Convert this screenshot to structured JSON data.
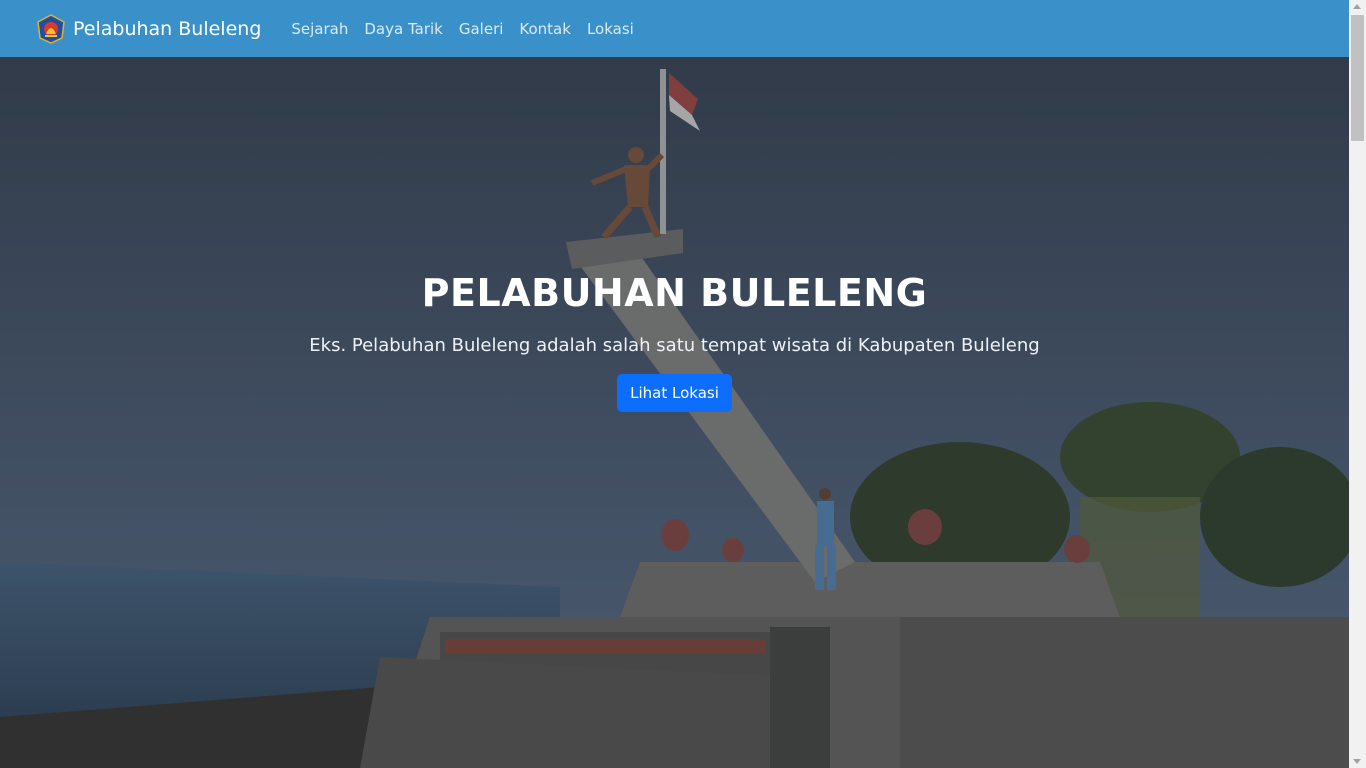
{
  "navbar": {
    "brand": "Pelabuhan Buleleng",
    "links": [
      {
        "label": "Sejarah"
      },
      {
        "label": "Daya Tarik"
      },
      {
        "label": "Galeri"
      },
      {
        "label": "Kontak"
      },
      {
        "label": "Lokasi"
      }
    ],
    "background": "#3a91c9"
  },
  "hero": {
    "title": "PELABUHAN BULELENG",
    "subtitle": "Eks. Pelabuhan Buleleng adalah salah satu tempat wisata di Kabupaten Buleleng",
    "button_label": "Lihat Lokasi",
    "button_color": "#0d6efd"
  },
  "icons": {
    "brand_logo": "buleleng-regency-emblem-icon"
  }
}
